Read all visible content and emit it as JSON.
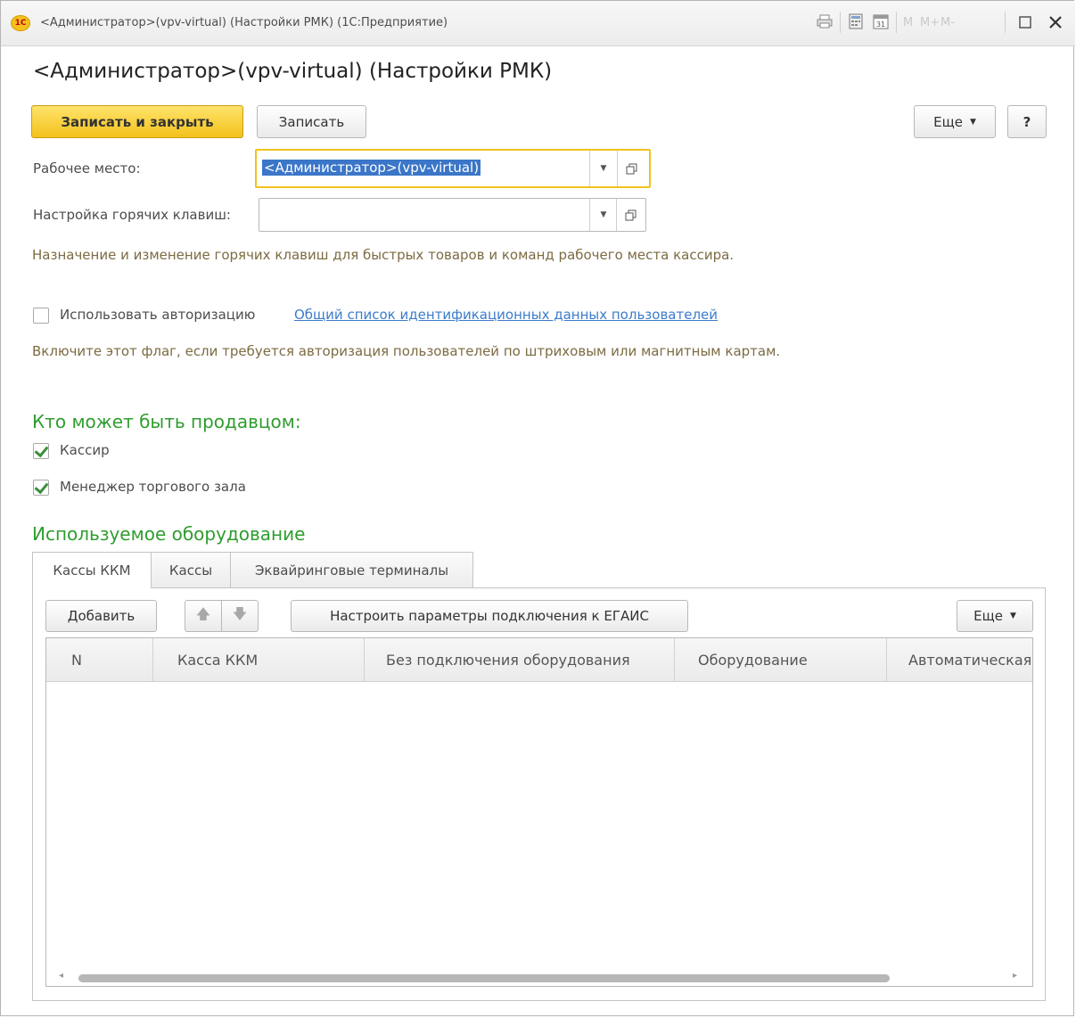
{
  "window": {
    "title": "<Администратор>(vpv-virtual) (Настройки РМК)  (1С:Предприятие)",
    "logo": "1С",
    "mlabels": [
      "M",
      "M+",
      "M-"
    ]
  },
  "form": {
    "title": "<Администратор>(vpv-virtual) (Настройки РМК)",
    "buttons": {
      "save_close": "Записать и закрыть",
      "save": "Записать",
      "more": "Еще",
      "help": "?"
    },
    "workplace": {
      "label": "Рабочее место:",
      "value": "<Администратор>(vpv-virtual)"
    },
    "hotkeys": {
      "label": "Настройка горячих клавиш:",
      "value": "",
      "hint": "Назначение и изменение горячих клавиш для быстрых товаров и команд рабочего места кассира."
    },
    "auth": {
      "label": "Использовать авторизацию",
      "checked": false,
      "link": "Общий список идентификационных данных пользователей",
      "hint": "Включите этот флаг, если требуется авторизация пользователей по штриховым или магнитным картам."
    },
    "sellers": {
      "title": "Кто может быть продавцом:",
      "cashier": "Кассир",
      "manager": "Менеджер торгового зала"
    },
    "equipment": {
      "title": "Используемое оборудование",
      "tabs": [
        "Кассы ККМ",
        "Кассы",
        "Эквайринговые терминалы"
      ],
      "toolbar": {
        "add": "Добавить",
        "egais": "Настроить параметры подключения к ЕГАИС",
        "more": "Еще"
      },
      "columns": [
        "N",
        "Касса ККМ",
        "Без подключения оборудования",
        "Оборудование",
        "Автоматическая"
      ]
    }
  },
  "colors": {
    "accent_yellow": "#f3c21b",
    "section_green": "#2f9d2f",
    "link_blue": "#3c7ccb",
    "hint_brown": "#7c6b42"
  }
}
